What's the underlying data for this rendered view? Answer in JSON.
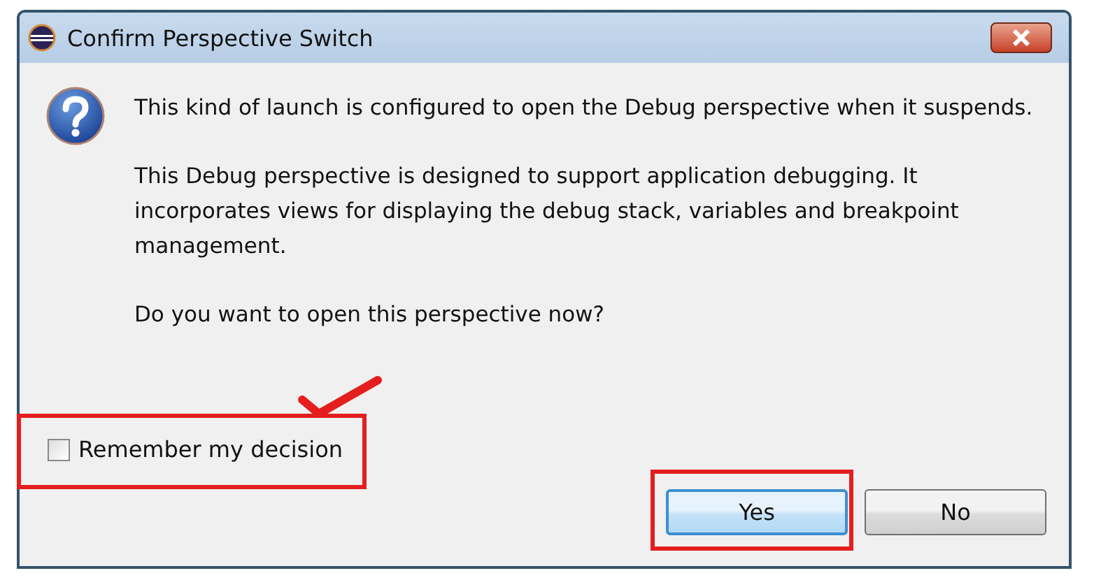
{
  "window": {
    "title": "Confirm Perspective Switch"
  },
  "message": [
    "This kind of launch is configured to open the Debug perspective when it suspends.",
    "This Debug perspective is designed to support application debugging.  It incorporates views for displaying the debug stack, variables and breakpoint management.",
    "Do you want to open this perspective now?"
  ],
  "checkbox": {
    "label": "Remember my decision",
    "checked": false
  },
  "buttons": [
    {
      "label": "Yes",
      "default": true
    },
    {
      "label": "No",
      "default": false
    }
  ]
}
